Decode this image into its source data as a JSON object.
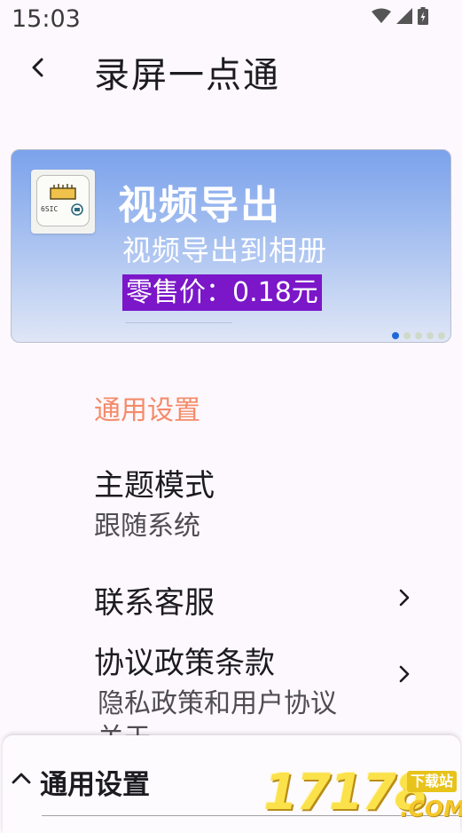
{
  "status_bar": {
    "time": "15:03",
    "icons": [
      "wifi-icon",
      "signal-icon",
      "battery-icon"
    ]
  },
  "app_bar": {
    "title": "录屏一点通",
    "back_icon": "back-arrow-icon"
  },
  "banner": {
    "title": "视频导出",
    "subtitle": "视频导出到相册",
    "price": "零售价：0.18元",
    "thumbnail_label": "6SIC",
    "page_count": 5,
    "active_page": 1,
    "colors": {
      "gradient_top": "#7ba2ec",
      "gradient_bottom": "#dfe6f6",
      "price_bg": "#7b16c9",
      "dot_active": "#1d69d8"
    }
  },
  "settings": {
    "section_header": "通用设置",
    "section_color": "#f48b6a",
    "items": [
      {
        "title": "主题模式",
        "subtitle": "跟随系统"
      },
      {
        "title": "联系客服"
      },
      {
        "title": "协议政策条款",
        "subtitle": "隐私政策和用户协议"
      },
      {
        "title": "关于"
      }
    ]
  },
  "bottom_sheet": {
    "title": "通用设置",
    "chevron_icon": "chevron-up-icon"
  },
  "watermark": {
    "digits": "17178",
    "tag": "下载站",
    "domain": ".COM"
  }
}
